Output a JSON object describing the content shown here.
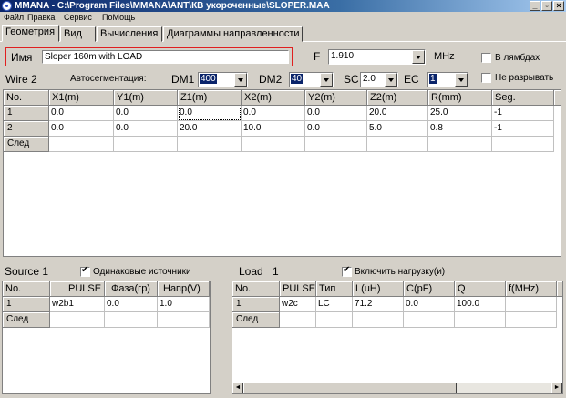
{
  "window": {
    "title": "MMANA - C:\\Program Files\\MMANA\\ANT\\КВ укороченные\\SLOPER.MAA",
    "minimize": "_",
    "restore": "▫",
    "close": "×"
  },
  "menu": [
    "Файл",
    "Правка",
    "Сервис",
    "ПоМощь"
  ],
  "tabs": [
    "Геометрия",
    "Вид",
    "Вычисления",
    "Диаграммы направленности"
  ],
  "header": {
    "name_label": "Имя",
    "name_value": "Sloper 160m with LOAD",
    "freq_label": "F",
    "freq_value": "1.910",
    "freq_unit": "MHz",
    "lambda_label": "В лямбдах",
    "nobreak_label": "Не разрывать"
  },
  "wire_bar": {
    "wire_label": "Wire 2",
    "autoseg_label": "Автосегментация:",
    "dm1_label": "DM1",
    "dm1_value": "400",
    "dm2_label": "DM2",
    "dm2_value": "40",
    "sc_label": "SC",
    "sc_value": "2.0",
    "ec_label": "EC",
    "ec_value": "1"
  },
  "wire_table": {
    "columns": [
      "No.",
      "X1(m)",
      "Y1(m)",
      "Z1(m)",
      "X2(m)",
      "Y2(m)",
      "Z2(m)",
      "R(mm)",
      "Seg."
    ],
    "rows": [
      [
        "1",
        "0.0",
        "0.0",
        "0.0",
        "0.0",
        "0.0",
        "20.0",
        "25.0",
        "-1"
      ],
      [
        "2",
        "0.0",
        "0.0",
        "20.0",
        "10.0",
        "0.0",
        "5.0",
        "0.8",
        "-1"
      ]
    ],
    "next_label": "След"
  },
  "source": {
    "title": "Source 1",
    "same_label": "Одинаковые источники",
    "columns": [
      "No.",
      "PULSE",
      "Фаза(гр)",
      "Напр(V)"
    ],
    "rows": [
      [
        "1",
        "w2b1",
        "0.0",
        "1.0"
      ]
    ],
    "next_label": "След"
  },
  "load": {
    "title": "Load",
    "count": "1",
    "enable_label": "Включить нагрузку(и)",
    "columns": [
      "No.",
      "PULSE",
      "Тип",
      "L(uH)",
      "C(pF)",
      "Q",
      "f(MHz)"
    ],
    "rows": [
      [
        "1",
        "w2c",
        "LC",
        "71.2",
        "0.0",
        "100.0",
        ""
      ]
    ],
    "next_label": "След"
  },
  "icons": {
    "left_arrow": "◄",
    "right_arrow": "►",
    "down_arrow": "▼"
  }
}
